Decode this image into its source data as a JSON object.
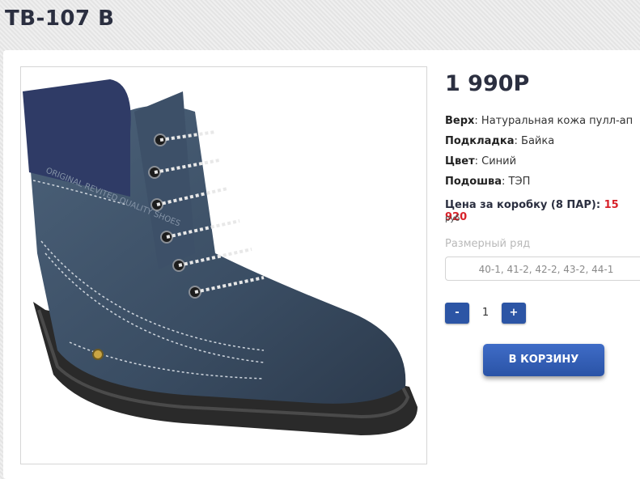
{
  "product": {
    "title": "ТВ-107 В",
    "price": "1 990Р",
    "specs": [
      {
        "label": "Верх",
        "value": ": Натуральная кожа пулл-ап"
      },
      {
        "label": "Подкладка",
        "value": ": Байка"
      },
      {
        "label": "Цвет",
        "value": ": Синий"
      },
      {
        "label": "Подошва",
        "value": ": ТЭП"
      }
    ],
    "box_price_label": "Цена за коробку (8 ПАР): ",
    "box_price_value": "15 920",
    "currency": "руб",
    "size_label": "Размерный ряд",
    "sizes": "40-1, 41-2, 42-2, 43-2, 44-1",
    "image_text": "ORIGINAL REVITED QUALITY SHOES"
  },
  "quantity": {
    "minus_label": "-",
    "value": "1",
    "plus_label": "+"
  },
  "cart_button_label": "В КОРЗИНУ",
  "colors": {
    "accent": "#2c55a5",
    "title": "#2b2f40",
    "price_highlight": "#d8222a"
  }
}
